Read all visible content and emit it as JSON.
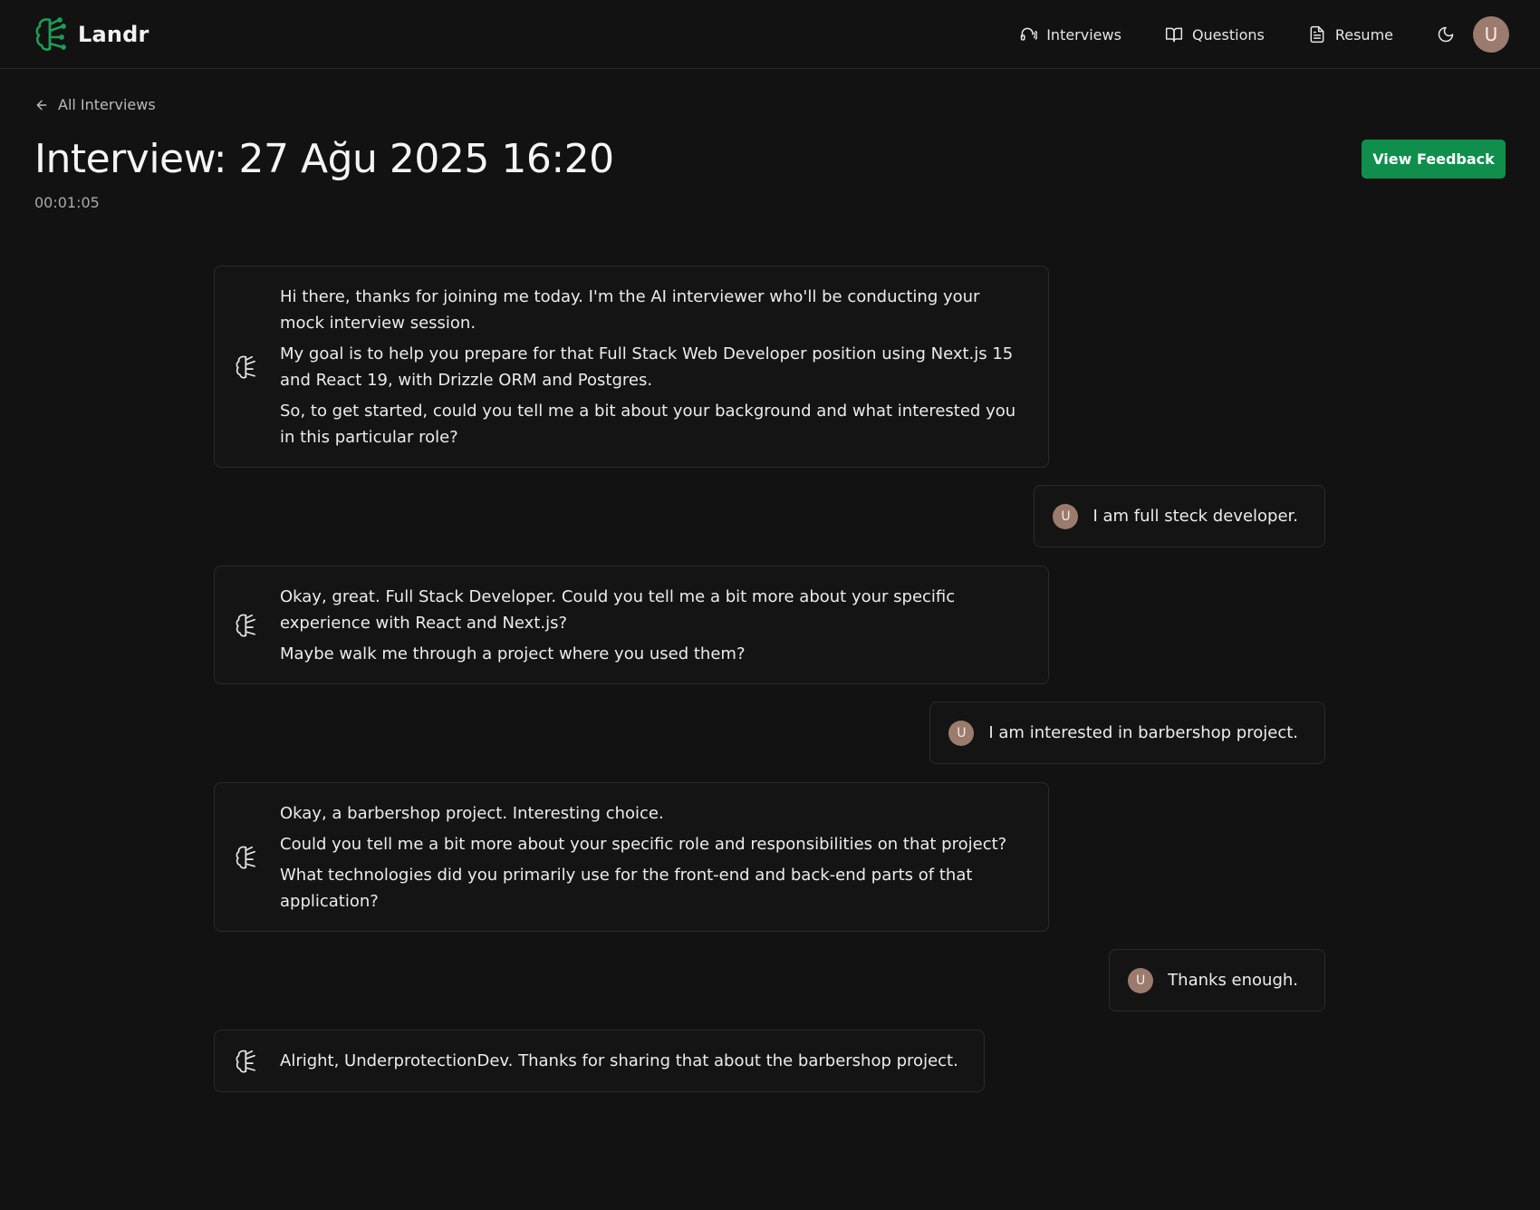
{
  "app": {
    "brand": "Landr",
    "accent": "#0f8f4b"
  },
  "nav": {
    "items": [
      {
        "label": "Interviews",
        "icon": "headset-icon"
      },
      {
        "label": "Questions",
        "icon": "book-icon"
      },
      {
        "label": "Resume",
        "icon": "document-icon"
      }
    ],
    "theme_icon": "moon-icon",
    "avatar_initial": "U"
  },
  "page": {
    "back_label": "All Interviews",
    "title": "Interview: 27 Ağu 2025 16:20",
    "duration": "00:01:05",
    "feedback_button": "View Feedback"
  },
  "messages": [
    {
      "role": "ai",
      "lines": [
        "Hi there, thanks for joining me today. I'm the AI interviewer who'll be conducting your mock interview session.",
        "My goal is to help you prepare for that Full Stack Web Developer position using Next.js 15 and React 19, with Drizzle ORM and Postgres.",
        "So, to get started, could you tell me a bit about your background and what interested you in this particular role?"
      ]
    },
    {
      "role": "user",
      "avatar": "U",
      "text": "I am full steck developer."
    },
    {
      "role": "ai",
      "lines": [
        "Okay, great. Full Stack Developer. Could you tell me a bit more about your specific experience with React and Next.js?",
        "Maybe walk me through a project where you used them?"
      ]
    },
    {
      "role": "user",
      "avatar": "U",
      "text": "I am interested in barbershop project."
    },
    {
      "role": "ai",
      "lines": [
        "Okay, a barbershop project. Interesting choice.",
        "Could you tell me a bit more about your specific role and responsibilities on that project?",
        "What technologies did you primarily use for the front-end and back-end parts of that application?"
      ]
    },
    {
      "role": "user",
      "avatar": "U",
      "text": "Thanks enough."
    },
    {
      "role": "ai",
      "lines": [
        "Alright, UnderprotectionDev. Thanks for sharing that about the barbershop project."
      ]
    }
  ]
}
